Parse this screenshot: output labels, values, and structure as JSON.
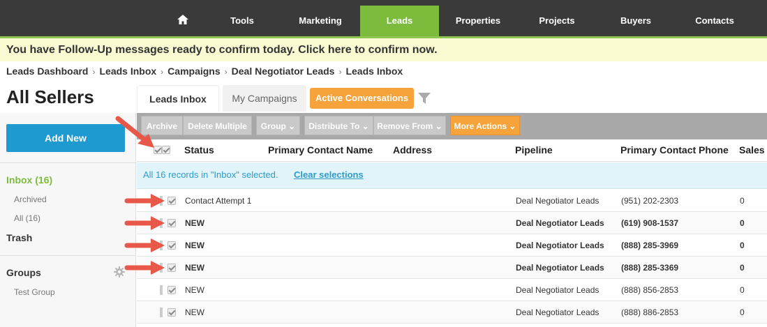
{
  "nav": {
    "items": [
      {
        "label": "Tools"
      },
      {
        "label": "Marketing"
      },
      {
        "label": "Leads"
      },
      {
        "label": "Properties"
      },
      {
        "label": "Projects"
      },
      {
        "label": "Buyers"
      },
      {
        "label": "Contacts"
      }
    ]
  },
  "followup": "You have Follow-Up messages ready to confirm today. Click here to confirm now.",
  "breadcrumb": [
    "Leads Dashboard",
    "Leads Inbox",
    "Campaigns",
    "Deal Negotiator Leads",
    "Leads Inbox"
  ],
  "page_title": "All Sellers",
  "tabs": {
    "leads_inbox": "Leads Inbox",
    "my_campaigns": "My Campaigns",
    "active_conversations": "Active Conversations"
  },
  "sidebar": {
    "add_new": "Add New",
    "inbox": "Inbox (16)",
    "archived": "Archived",
    "all": "All (16)",
    "trash": "Trash",
    "groups": "Groups",
    "test_group": "Test Group"
  },
  "toolbar": {
    "archive": "Archive",
    "delete_multiple": "Delete Multiple",
    "group": "Group ⌄",
    "distribute_to": "Distribute To ⌄",
    "remove_from": "Remove From ⌄",
    "more_actions": "More Actions ⌄"
  },
  "table": {
    "headers": [
      "Status",
      "Primary Contact Name",
      "Address",
      "Pipeline",
      "Primary Contact Phone",
      "Sales"
    ],
    "selection_text": "All 16 records in \"Inbox\" selected.",
    "clear_selections": "Clear selections",
    "rows": [
      {
        "status": "Contact Attempt 1",
        "pipeline": "Deal Negotiator Leads",
        "phone": "(951) 202-2303",
        "sales": "0",
        "bold": false
      },
      {
        "status": "NEW",
        "pipeline": "Deal Negotiator Leads",
        "phone": "(619) 908-1537",
        "sales": "0",
        "bold": true
      },
      {
        "status": "NEW",
        "pipeline": "Deal Negotiator Leads",
        "phone": "(888) 285-3969",
        "sales": "0",
        "bold": true
      },
      {
        "status": "NEW",
        "pipeline": "Deal Negotiator Leads",
        "phone": "(888) 285-3369",
        "sales": "0",
        "bold": true
      },
      {
        "status": "NEW",
        "pipeline": "Deal Negotiator Leads",
        "phone": "(888) 856-2853",
        "sales": "0",
        "bold": false
      },
      {
        "status": "NEW",
        "pipeline": "Deal Negotiator Leads",
        "phone": "(888) 886-2853",
        "sales": "0",
        "bold": false
      }
    ]
  },
  "colors": {
    "accent_green": "#7dbb3d",
    "orange": "#f5a33a",
    "blue": "#1f9ad1",
    "arrow_red": "#e8584a"
  }
}
